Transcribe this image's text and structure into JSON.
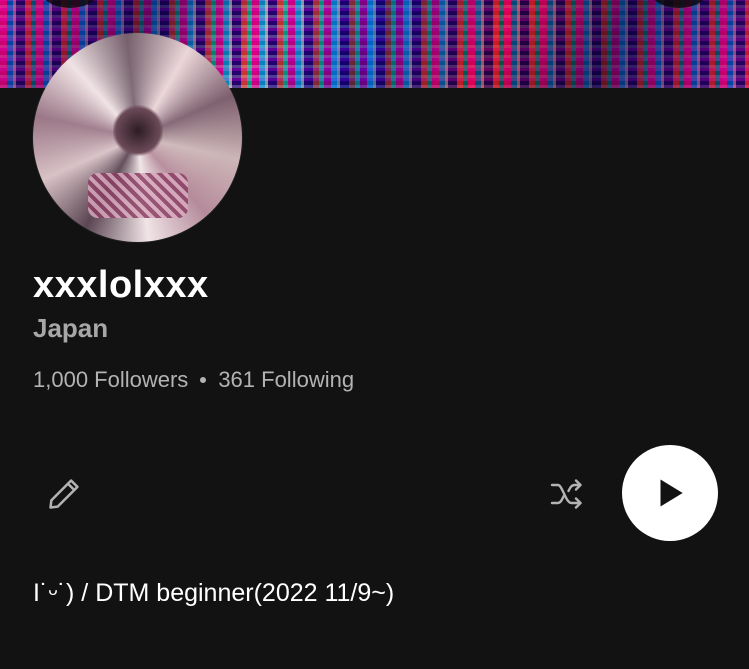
{
  "profile": {
    "username": "xxxlolxxx",
    "location": "Japan",
    "followers_label": "1,000 Followers",
    "following_label": "361 Following",
    "bio": "I˙ᵕ˙) / DTM beginner(2022 11/9~)"
  },
  "icons": {
    "edit": "pencil-icon",
    "shuffle": "shuffle-icon",
    "play": "play-icon"
  },
  "colors": {
    "background": "#121212",
    "text_primary": "#ffffff",
    "text_secondary": "#a7a7a7",
    "play_button": "#ffffff"
  }
}
